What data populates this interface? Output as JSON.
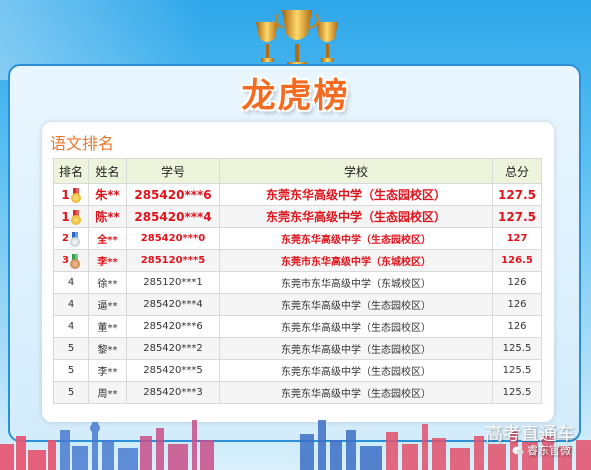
{
  "header": {
    "title": "龙虎榜"
  },
  "section": {
    "title": "语文排名"
  },
  "table": {
    "columns": [
      "排名",
      "姓名",
      "学号",
      "学校",
      "总分"
    ],
    "rows": [
      {
        "rank": "1",
        "medal": "gold",
        "name": "朱**",
        "id": "285420***6",
        "school": "东莞东华高级中学（生态园校区）",
        "score": "127.5"
      },
      {
        "rank": "1",
        "medal": "gold",
        "name": "陈**",
        "id": "285420***4",
        "school": "东莞东华高级中学（生态园校区）",
        "score": "127.5"
      },
      {
        "rank": "2",
        "medal": "silver",
        "name": "全**",
        "id": "285420***0",
        "school": "东莞东华高级中学（生态园校区）",
        "score": "127"
      },
      {
        "rank": "3",
        "medal": "bronze",
        "name": "李**",
        "id": "285120***5",
        "school": "东莞市东华高级中学（东城校区）",
        "score": "126.5"
      },
      {
        "rank": "4",
        "medal": "",
        "name": "徐**",
        "id": "285120***1",
        "school": "东莞市东华高级中学（东城校区）",
        "score": "126"
      },
      {
        "rank": "4",
        "medal": "",
        "name": "逼**",
        "id": "285420***4",
        "school": "东莞东华高级中学（生态园校区）",
        "score": "126"
      },
      {
        "rank": "4",
        "medal": "",
        "name": "董**",
        "id": "285420***6",
        "school": "东莞东华高级中学（生态园校区）",
        "score": "126"
      },
      {
        "rank": "5",
        "medal": "",
        "name": "黎**",
        "id": "285420***2",
        "school": "东莞东华高级中学（生态园校区）",
        "score": "125.5"
      },
      {
        "rank": "5",
        "medal": "",
        "name": "李**",
        "id": "285420***5",
        "school": "东莞东华高级中学（生态园校区）",
        "score": "125.5"
      },
      {
        "rank": "5",
        "medal": "",
        "name": "周**",
        "id": "285420***3",
        "school": "东莞东华高级中学（生态园校区）",
        "score": "125.5"
      }
    ]
  },
  "watermark": {
    "line1": "高考直通车",
    "line2": "睿东官微"
  },
  "colors": {
    "accent": "#f36b21",
    "highlight": "#e0131b",
    "border": "#2a8fd6"
  }
}
